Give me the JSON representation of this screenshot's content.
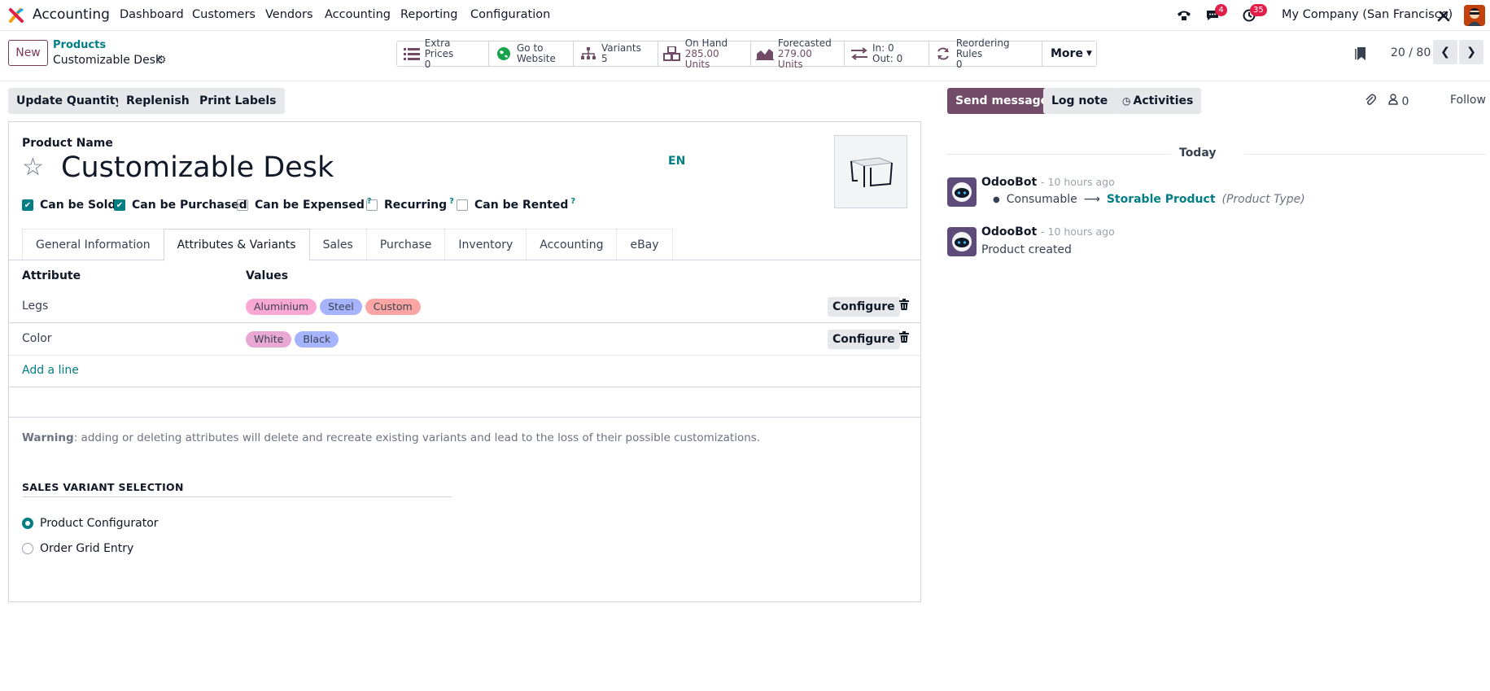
{
  "navbar": {
    "app_name": "Accounting",
    "menu": [
      "Dashboard",
      "Customers",
      "Vendors",
      "Accounting",
      "Reporting",
      "Configuration"
    ],
    "messages_badge": "4",
    "activities_badge": "35",
    "company": "My Company (San Francisco)"
  },
  "control_panel": {
    "new_label": "New",
    "breadcrumb_parent": "Products",
    "breadcrumb_current": "Customizable Desk",
    "smart_buttons": [
      {
        "label": "Extra Prices",
        "value": "0",
        "icon": "list-icon"
      },
      {
        "label": "Go to",
        "value": "Website",
        "icon": "globe-icon"
      },
      {
        "label": "Variants",
        "value": "5",
        "icon": "sitemap-icon"
      },
      {
        "label": "On Hand",
        "value": "285.00 Units",
        "icon": "cubes-icon"
      },
      {
        "label": "Forecasted",
        "value": "279.00 Units",
        "icon": "area-chart-icon"
      },
      {
        "label": "In: 0",
        "value": "Out: 0",
        "icon": "exchange-icon"
      },
      {
        "label": "Reordering Rules",
        "value": "0",
        "icon": "refresh-icon"
      }
    ],
    "more_label": "More",
    "pager": "20 / 80"
  },
  "actions": {
    "update_quantity": "Update Quantity",
    "replenish": "Replenish",
    "print_labels": "Print Labels"
  },
  "form": {
    "product_name_label": "Product Name",
    "product_name": "Customizable Desk",
    "lang": "EN",
    "checkboxes": [
      {
        "label": "Can be Sold",
        "checked": true
      },
      {
        "label": "Can be Purchased",
        "checked": true
      },
      {
        "label": "Can be Expensed",
        "checked": false,
        "help": "?"
      },
      {
        "label": "Recurring",
        "checked": false,
        "help": "?"
      },
      {
        "label": "Can be Rented",
        "checked": false,
        "help": "?"
      }
    ],
    "tabs": [
      "General Information",
      "Attributes & Variants",
      "Sales",
      "Purchase",
      "Inventory",
      "Accounting",
      "eBay"
    ],
    "active_tab": "Attributes & Variants",
    "table": {
      "headers": [
        "Attribute",
        "Values"
      ],
      "rows": [
        {
          "attribute": "Legs",
          "values": [
            {
              "label": "Aluminium",
              "color": "#f9a8d4"
            },
            {
              "label": "Steel",
              "color": "#a5b4fc"
            },
            {
              "label": "Custom",
              "color": "#fca5a5"
            }
          ]
        },
        {
          "attribute": "Color",
          "values": [
            {
              "label": "White",
              "color": "#e9a8d4"
            },
            {
              "label": "Black",
              "color": "#a5b4fc"
            }
          ]
        }
      ],
      "configure_label": "Configure",
      "add_line": "Add a line"
    },
    "warning_prefix": "Warning",
    "warning_text": ": adding or deleting attributes will delete and recreate existing variants and lead to the loss of their possible customizations.",
    "section_title": "SALES VARIANT SELECTION",
    "radios": [
      {
        "label": "Product Configurator",
        "selected": true
      },
      {
        "label": "Order Grid Entry",
        "selected": false
      }
    ]
  },
  "chatter": {
    "send_message": "Send message",
    "log_note": "Log note",
    "activities": "Activities",
    "followers_count": "0",
    "follow": "Follow",
    "date_separator": "Today",
    "messages": [
      {
        "author": "OdooBot",
        "time": "- 10 hours ago",
        "tracking": {
          "old": "Consumable",
          "new": "Storable Product",
          "field": "(Product Type)"
        }
      },
      {
        "author": "OdooBot",
        "time": "- 10 hours ago",
        "body": "Product created"
      }
    ]
  },
  "colors": {
    "primary": "#714b67",
    "accent": "#017e84",
    "badge": "#e11d48"
  }
}
